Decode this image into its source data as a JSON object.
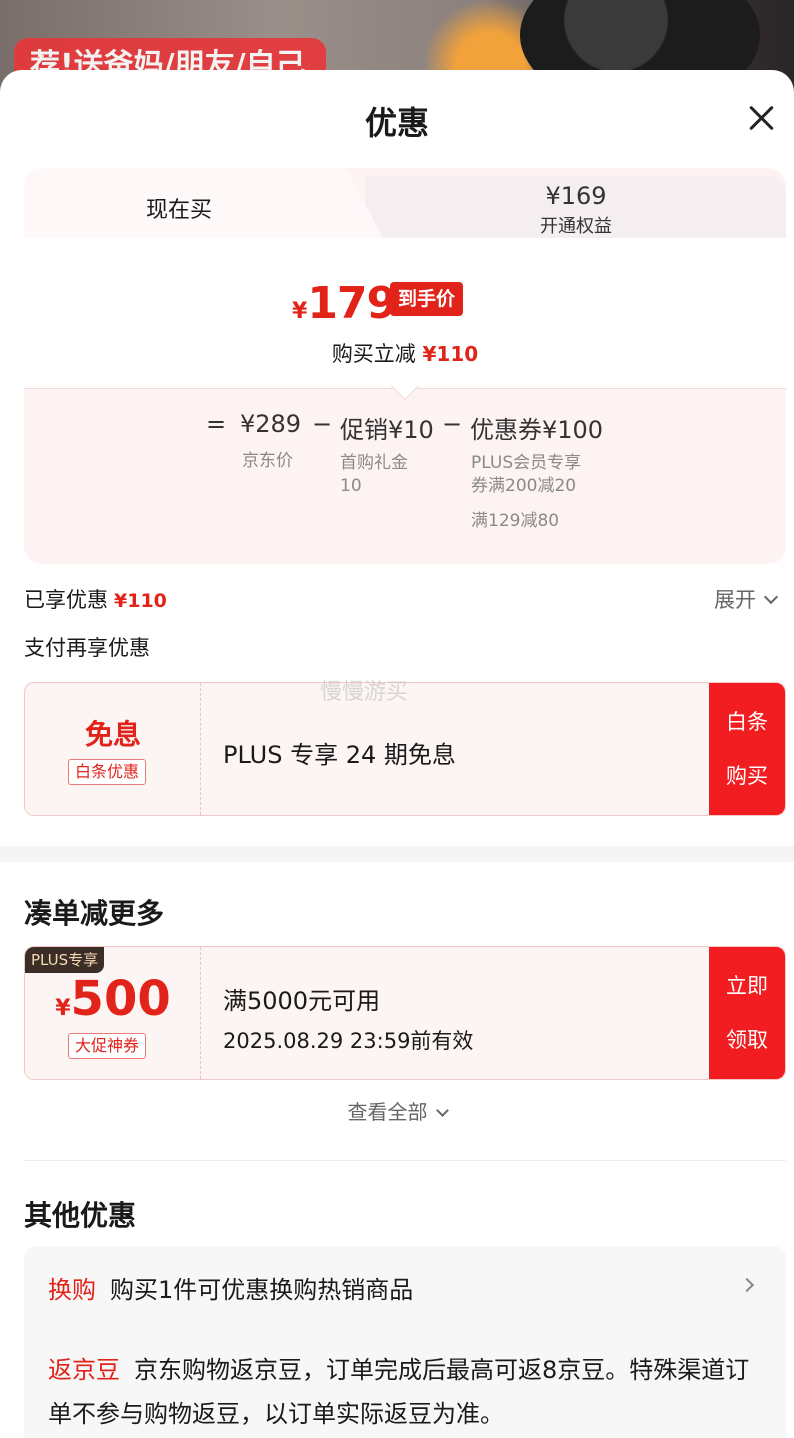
{
  "backdrop": {
    "promo_text": "荐!送爸妈/朋友/自己"
  },
  "sheet": {
    "title": "优惠"
  },
  "price_card": {
    "tab_now": "现在买",
    "tab_plus_price": "¥169",
    "tab_plus_label": "开通权益",
    "final_price_symbol": "¥",
    "final_price": "179",
    "final_price_tag": "到手价",
    "saving_label": "购买立减",
    "saving_amount": "¥110",
    "formula": {
      "eq": "=",
      "jd_price": "¥289",
      "minus1": "−",
      "promo": "促销¥10",
      "minus2": "−",
      "coupon": "优惠券¥100"
    },
    "breakdown": {
      "jd_price_label": "京东价",
      "promo_line1": "首购礼金",
      "promo_line2": "10",
      "coupon_line1": "PLUS会员专享",
      "coupon_line2": "券满200减20",
      "coupon_line3": "满129减80"
    }
  },
  "enjoyed": {
    "label": "已享优惠",
    "amount": "¥110",
    "expand": "展开"
  },
  "pay_more": {
    "label": "支付再享优惠"
  },
  "watermark": "慢慢游买",
  "baitiao_coupon": {
    "title": "免息",
    "tag": "白条优惠",
    "desc": "PLUS 专享 24 期免息",
    "cta_line1": "白条",
    "cta_line2": "购买"
  },
  "bundle": {
    "title": "凑单减更多",
    "coupon": {
      "badge": "PLUS专享",
      "symbol": "¥",
      "value": "500",
      "tag": "大促神券",
      "desc1": "满5000元可用",
      "desc2": "2025.08.29 23:59前有效",
      "cta_line1": "立即",
      "cta_line2": "领取"
    },
    "view_all": "查看全部"
  },
  "other": {
    "title": "其他优惠",
    "swap_label": "换购",
    "swap_text": "购买1件可优惠换购热销商品",
    "bean_label": "返京豆",
    "bean_text": "京东购物返京豆，订单完成后最高可返8京豆。特殊渠道订单不参与购物返豆，以订单实际返豆为准。"
  }
}
